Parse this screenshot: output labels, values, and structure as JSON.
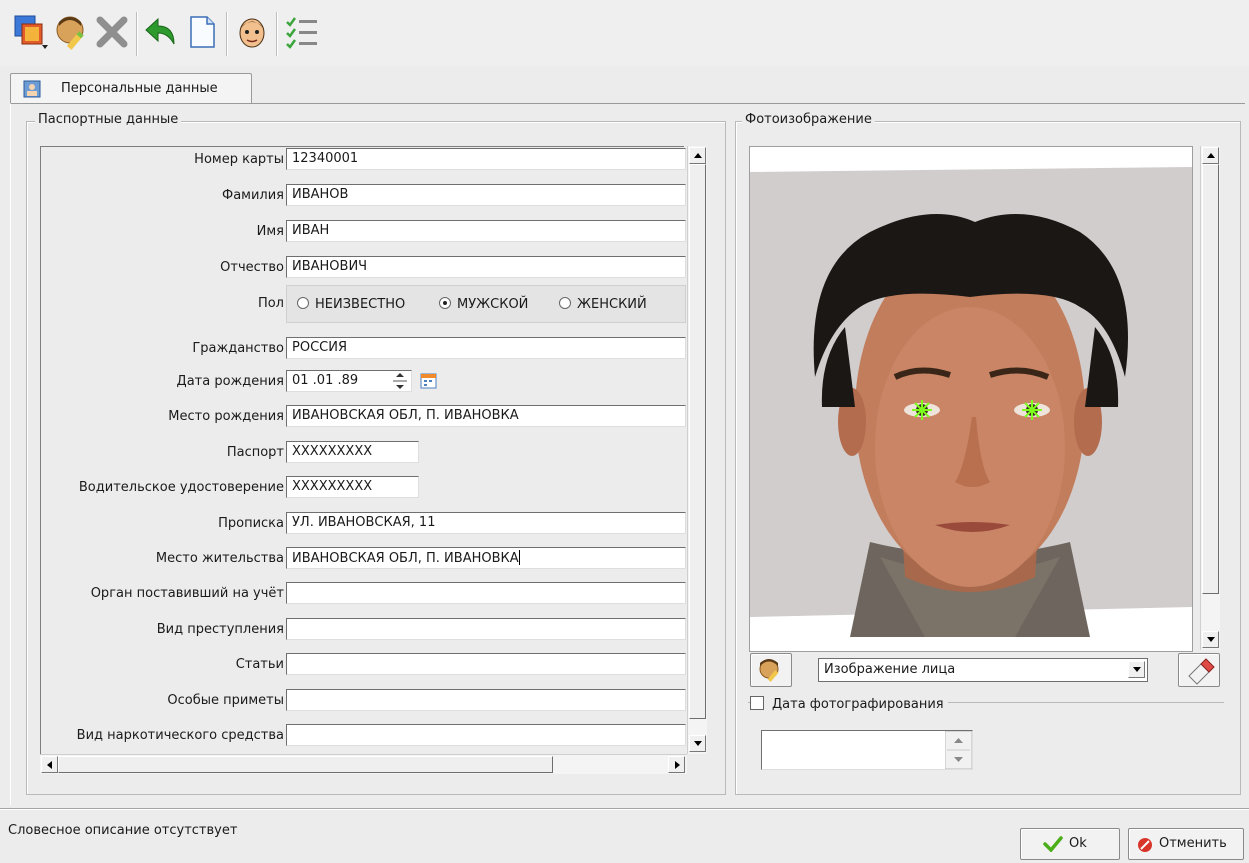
{
  "toolbar": {
    "buttons": [
      {
        "name": "select-image-dropdown-icon"
      },
      {
        "name": "edit-face-icon"
      },
      {
        "name": "delete-icon"
      },
      {
        "name": "undo-icon"
      },
      {
        "name": "new-document-icon"
      },
      {
        "name": "face-icon"
      },
      {
        "name": "checklist-icon"
      }
    ]
  },
  "tab": {
    "label": "Персональные данные"
  },
  "passport": {
    "title": "Паспортные данные",
    "fields": [
      {
        "label": "Номер карты",
        "value": "12340001"
      },
      {
        "label": "Фамилия",
        "value": "ИВАНОВ"
      },
      {
        "label": "Имя",
        "value": "ИВАН"
      },
      {
        "label": "Отчество",
        "value": "ИВАНОВИЧ"
      },
      {
        "label": "Пол",
        "value": ""
      },
      {
        "label": "Гражданство",
        "value": "РОССИЯ"
      },
      {
        "label": "Дата рождения",
        "value": "01 .01 .89"
      },
      {
        "label": "Место рождения",
        "value": "ИВАНОВСКАЯ ОБЛ, П. ИВАНОВКА"
      },
      {
        "label": "Паспорт",
        "value": "XXXXXXXXX"
      },
      {
        "label": "Водительское удостоверение",
        "value": "XXXXXXXXX"
      },
      {
        "label": "Прописка",
        "value": "УЛ. ИВАНОВСКАЯ, 11"
      },
      {
        "label": "Место жительства",
        "value": "ИВАНОВСКАЯ ОБЛ, П. ИВАНОВКА"
      },
      {
        "label": "Орган поставивший на учёт",
        "value": ""
      },
      {
        "label": "Вид преступления",
        "value": ""
      },
      {
        "label": "Статьи",
        "value": ""
      },
      {
        "label": "Особые приметы",
        "value": ""
      },
      {
        "label": "Вид наркотического средства",
        "value": ""
      }
    ],
    "gender": {
      "options": [
        "НЕИЗВЕСТНО",
        "МУЖСКОЙ",
        "ЖЕНСКИЙ"
      ],
      "selected": "МУЖСКОЙ"
    }
  },
  "photo": {
    "title": "Фотоизображение",
    "image_type": "Изображение лица",
    "date_label": "Дата фотографирования",
    "date_checked": false,
    "date_value": ""
  },
  "status": {
    "text": "Словесное описание отсутствует"
  },
  "buttons": {
    "ok": "Ok",
    "cancel": "Отменить"
  },
  "colors": {
    "ok_check": "#4caf1a",
    "cancel_red": "#d9362b",
    "eye_marker": "#7cff1c"
  }
}
